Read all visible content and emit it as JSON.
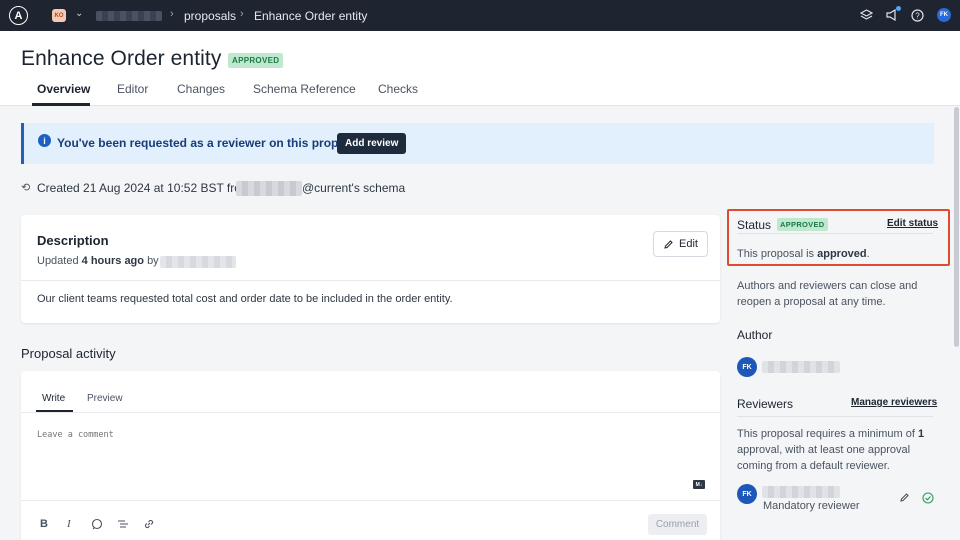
{
  "topbar": {
    "logo_letter": "A",
    "org_badge": "KO",
    "breadcrumb": [
      "proposals",
      "Enhance Order entity"
    ],
    "avatar": "FK"
  },
  "header": {
    "title": "Enhance Order entity",
    "badge": "APPROVED",
    "tabs": [
      "Overview",
      "Editor",
      "Changes",
      "Schema Reference",
      "Checks"
    ]
  },
  "banner": {
    "text": "You've been requested as a reviewer on this proposal",
    "button": "Add review"
  },
  "created": {
    "text": "Created 21 Aug 2024 at 10:52 BST from",
    "suffix": "@current's schema"
  },
  "description": {
    "title": "Description",
    "updated_prefix": "Updated",
    "updated_time": "4 hours ago",
    "updated_by": "by",
    "edit_label": "Edit",
    "body": "Our client teams requested total cost and order date to be included in the order entity."
  },
  "activity": {
    "title": "Proposal activity",
    "tabs": [
      "Write",
      "Preview"
    ],
    "placeholder": "Leave a comment",
    "markdown_badge": "M↓",
    "comment_button": "Comment"
  },
  "sidebar": {
    "status_label": "Status",
    "status_badge": "APPROVED",
    "edit_status": "Edit status",
    "status_prefix": "This proposal is",
    "status_value": "approved",
    "status_note": "Authors and reviewers can close and reopen a proposal at any time.",
    "author_heading": "Author",
    "author_initials": "FK",
    "reviewers_heading": "Reviewers",
    "manage_reviewers": "Manage reviewers",
    "reviewers_note_prefix": "This proposal requires a minimum of",
    "reviewers_min": "1",
    "reviewers_note_suffix": "approval, with at least one approval coming from a default reviewer.",
    "reviewer_initials": "FK",
    "reviewer_role": "Mandatory reviewer"
  },
  "colors": {
    "topbar": "#1e2430",
    "approved_bg": "#bfe8cf",
    "approved_text": "#1b7a45",
    "banner_bg": "#e2effc",
    "highlight": "#e04a2f",
    "avatar": "#1d57b8"
  }
}
